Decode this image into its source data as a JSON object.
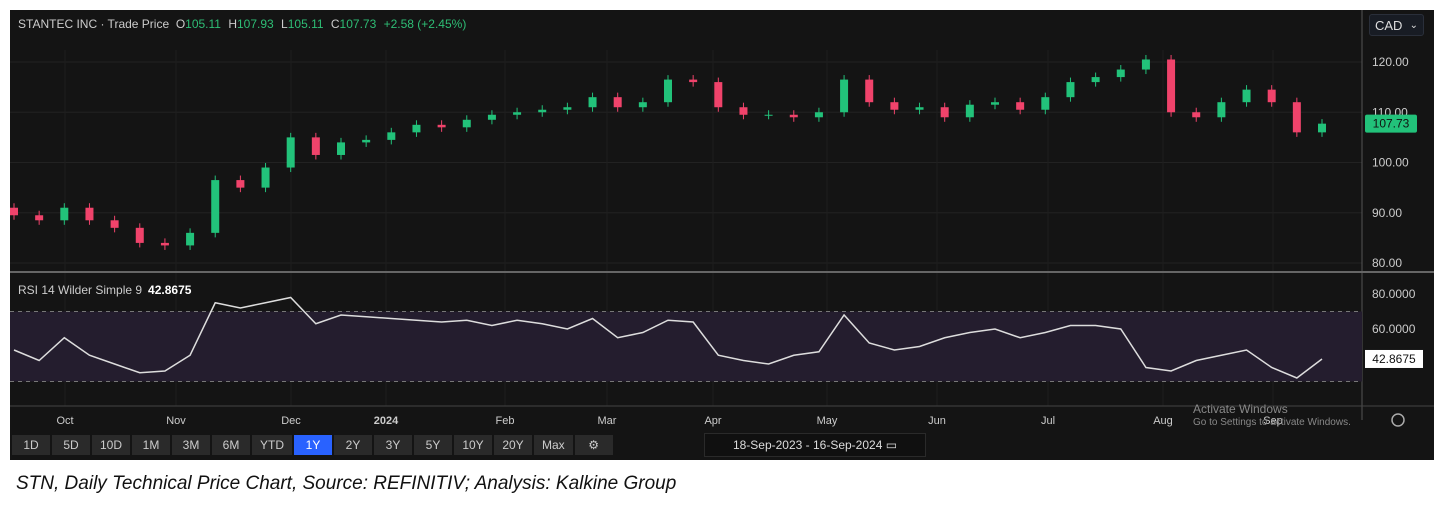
{
  "header": {
    "title": "STANTEC INC · Trade Price",
    "open_label": "O",
    "open": "105.11",
    "high_label": "H",
    "high": "107.93",
    "low_label": "L",
    "low": "105.11",
    "close_label": "C",
    "close": "107.73",
    "change": "+2.58 (+2.45%)"
  },
  "currency": "CAD",
  "rsi_label": "RSI 14 Wilder Simple 9",
  "rsi_value": "42.8675",
  "last_price_tag": "107.73",
  "toolbar": {
    "ranges": [
      "1D",
      "5D",
      "10D",
      "1M",
      "3M",
      "6M",
      "YTD",
      "1Y",
      "2Y",
      "3Y",
      "5Y",
      "10Y",
      "20Y",
      "Max"
    ],
    "active": "1Y",
    "date_range": "18-Sep-2023  -  16-Sep-2024"
  },
  "watermark": {
    "line1": "Activate Windows",
    "line2": "Go to Settings to activate Windows."
  },
  "caption": "STN, Daily Technical Price Chart, Source: REFINITIV; Analysis: Kalkine Group",
  "colors": {
    "up": "#22c27a",
    "down": "#f0436b",
    "background": "#141414",
    "rsi_band": "#241d2e"
  },
  "chart_data": [
    {
      "type": "candlestick",
      "ylim": [
        80,
        124
      ],
      "yticks": [
        "120.00",
        "110.00",
        "100.00",
        "90.00",
        "80.00"
      ],
      "x_labels": [
        "Oct",
        "Nov",
        "Dec",
        "2024",
        "Feb",
        "Mar",
        "Apr",
        "May",
        "Jun",
        "Jul",
        "Aug",
        "Sep"
      ],
      "close": [
        89.5,
        88.5,
        91,
        88.5,
        87,
        84,
        83.5,
        86,
        96.5,
        95,
        99,
        105,
        101.5,
        104,
        104.5,
        106,
        107.5,
        107,
        108.5,
        109.5,
        110,
        110.5,
        111,
        113,
        111,
        112,
        116.5,
        116,
        111,
        109.5,
        109.5,
        109,
        110,
        116.5,
        112,
        110.5,
        111,
        109,
        111.5,
        112,
        110.5,
        113,
        116,
        117,
        118.5,
        120.5,
        110,
        109,
        112,
        114.5,
        112,
        106,
        107.73
      ],
      "first_open": 91
    },
    {
      "type": "line",
      "ylim": [
        15,
        85
      ],
      "yticks": [
        "80.0000",
        "60.0000"
      ],
      "band": [
        30,
        70
      ],
      "values": [
        48,
        42,
        55,
        45,
        40,
        35,
        36,
        45,
        75,
        72,
        75,
        78,
        63,
        68,
        67,
        66,
        65,
        64,
        65,
        62,
        65,
        63,
        60,
        66,
        55,
        58,
        65,
        64,
        45,
        42,
        40,
        45,
        47,
        68,
        52,
        48,
        50,
        55,
        58,
        60,
        55,
        58,
        62,
        62,
        60,
        38,
        36,
        42,
        45,
        48,
        38,
        32,
        42.87
      ]
    }
  ]
}
